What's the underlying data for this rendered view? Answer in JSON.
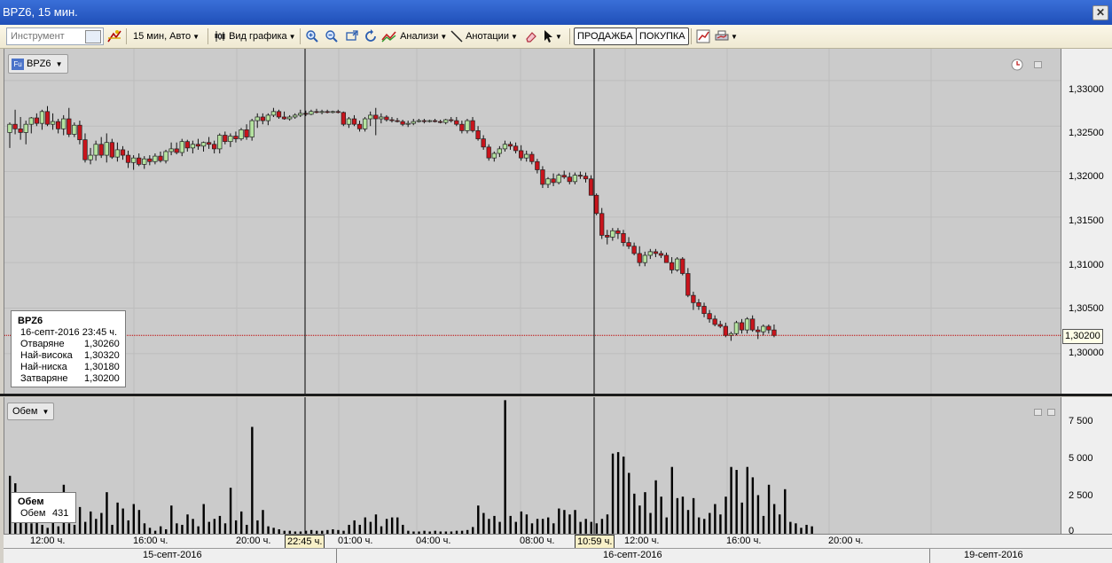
{
  "window": {
    "title": "BPZ6, 15 мин."
  },
  "toolbar": {
    "instrument_placeholder": "Инструмент",
    "interval": "15 мин, Авто",
    "chart_type": "Вид графика",
    "analysis": "Анализи",
    "annotations": "Анотации",
    "sell": "ПРОДАЖБА",
    "buy": "ПОКУПКА"
  },
  "chart": {
    "symbol": "BPZ6",
    "info": {
      "symbol": "BPZ6",
      "datetime": "16-септ-2016 23:45 ч.",
      "rows": [
        {
          "label": "Отваряне",
          "value": "1,30260"
        },
        {
          "label": "Най-висока",
          "value": "1,30320"
        },
        {
          "label": "Най-ниска",
          "value": "1,30180"
        },
        {
          "label": "Затваряне",
          "value": "1,30200"
        }
      ]
    },
    "price_axis": [
      "1,33000",
      "1,32500",
      "1,32000",
      "1,31500",
      "1,31000",
      "1,30500",
      "1,30000"
    ],
    "last_price": "1,30200",
    "volume_axis": [
      "7 500",
      "5 000",
      "2 500",
      "0"
    ],
    "volume_label": "Обем",
    "volume_info": {
      "title": "Обем",
      "label": "Обем",
      "value": "431"
    },
    "time_axis": [
      "12:00 ч.",
      "16:00 ч.",
      "20:00 ч.",
      "01:00 ч.",
      "04:00 ч.",
      "08:00 ч.",
      "12:00 ч.",
      "16:00 ч.",
      "20:00 ч."
    ],
    "highlight_times": [
      "22:45 ч.",
      "10:59 ч."
    ],
    "dates": [
      "15-септ-2016",
      "16-септ-2016",
      "19-септ-2016"
    ]
  },
  "colors": {
    "up": "#b5e3a0",
    "down": "#c8141c",
    "background": "#cbcbcb",
    "price_line": "#c00000"
  },
  "chart_data": {
    "type": "candlestick",
    "title": "BPZ6, 15 мин.",
    "y_range": [
      1.2955,
      1.3335
    ],
    "ohlc": [
      [
        1.3243,
        1.3254,
        1.3226,
        1.3252
      ],
      [
        1.3252,
        1.3268,
        1.3241,
        1.3247
      ],
      [
        1.3247,
        1.326,
        1.3235,
        1.3243
      ],
      [
        1.3243,
        1.3256,
        1.323,
        1.3252
      ],
      [
        1.3252,
        1.326,
        1.3242,
        1.3259
      ],
      [
        1.3259,
        1.3264,
        1.325,
        1.3253
      ],
      [
        1.3253,
        1.3268,
        1.3246,
        1.3266
      ],
      [
        1.3266,
        1.3272,
        1.325,
        1.3252
      ],
      [
        1.3252,
        1.3264,
        1.3246,
        1.3255
      ],
      [
        1.3255,
        1.3258,
        1.3242,
        1.3247
      ],
      [
        1.3247,
        1.3262,
        1.324,
        1.3258
      ],
      [
        1.3258,
        1.327,
        1.3238,
        1.3241
      ],
      [
        1.3241,
        1.3254,
        1.3238,
        1.3251
      ],
      [
        1.3251,
        1.3256,
        1.323,
        1.3235
      ],
      [
        1.3235,
        1.3242,
        1.321,
        1.3213
      ],
      [
        1.3213,
        1.3226,
        1.3208,
        1.3218
      ],
      [
        1.3218,
        1.3234,
        1.3212,
        1.323
      ],
      [
        1.323,
        1.3238,
        1.3215,
        1.3218
      ],
      [
        1.3218,
        1.3242,
        1.321,
        1.3232
      ],
      [
        1.3232,
        1.3236,
        1.3214,
        1.3216
      ],
      [
        1.3216,
        1.3232,
        1.3211,
        1.3224
      ],
      [
        1.3224,
        1.3228,
        1.3213,
        1.3218
      ],
      [
        1.3218,
        1.3223,
        1.3204,
        1.321
      ],
      [
        1.321,
        1.3218,
        1.3202,
        1.3215
      ],
      [
        1.3215,
        1.322,
        1.3206,
        1.3208
      ],
      [
        1.3208,
        1.3217,
        1.3203,
        1.3214
      ],
      [
        1.3214,
        1.3218,
        1.3207,
        1.3211
      ],
      [
        1.3211,
        1.322,
        1.3208,
        1.3217
      ],
      [
        1.3217,
        1.3222,
        1.321,
        1.3212
      ],
      [
        1.3212,
        1.3224,
        1.3209,
        1.3222
      ],
      [
        1.3222,
        1.3232,
        1.3218,
        1.3225
      ],
      [
        1.3225,
        1.3232,
        1.3219,
        1.3221
      ],
      [
        1.3221,
        1.3236,
        1.3217,
        1.3233
      ],
      [
        1.3233,
        1.3235,
        1.3222,
        1.3226
      ],
      [
        1.3226,
        1.3234,
        1.322,
        1.323
      ],
      [
        1.323,
        1.3236,
        1.3224,
        1.3228
      ],
      [
        1.3228,
        1.3233,
        1.3222,
        1.3232
      ],
      [
        1.3232,
        1.3238,
        1.3225,
        1.323
      ],
      [
        1.323,
        1.3234,
        1.322,
        1.3225
      ],
      [
        1.3225,
        1.3242,
        1.322,
        1.324
      ],
      [
        1.324,
        1.3244,
        1.323,
        1.3233
      ],
      [
        1.3233,
        1.3242,
        1.3227,
        1.3239
      ],
      [
        1.3239,
        1.3244,
        1.3232,
        1.3236
      ],
      [
        1.3236,
        1.3248,
        1.3234,
        1.3246
      ],
      [
        1.3246,
        1.3252,
        1.3235,
        1.3238
      ],
      [
        1.3238,
        1.3258,
        1.3234,
        1.3256
      ],
      [
        1.3256,
        1.3264,
        1.3248,
        1.326
      ],
      [
        1.326,
        1.3264,
        1.3252,
        1.3256
      ],
      [
        1.3256,
        1.3264,
        1.3251,
        1.3262
      ],
      [
        1.3262,
        1.327,
        1.326,
        1.3266
      ],
      [
        1.3266,
        1.3268,
        1.3258,
        1.326
      ],
      [
        1.326,
        1.3266,
        1.3257,
        1.3258
      ],
      [
        1.3258,
        1.3262,
        1.3256,
        1.326
      ],
      [
        1.326,
        1.3264,
        1.3258,
        1.3262
      ],
      [
        1.3262,
        1.3268,
        1.326,
        1.3264
      ],
      [
        1.3264,
        1.3267,
        1.3261,
        1.3263
      ],
      [
        1.3263,
        1.3268,
        1.3262,
        1.3266
      ],
      [
        1.3266,
        1.3269,
        1.3264,
        1.3265
      ],
      [
        1.3265,
        1.3268,
        1.3263,
        1.3266
      ],
      [
        1.3266,
        1.3268,
        1.3264,
        1.3265
      ],
      [
        1.3265,
        1.3267,
        1.3264,
        1.3266
      ],
      [
        1.3266,
        1.3268,
        1.3264,
        1.3265
      ],
      [
        1.3265,
        1.3266,
        1.325,
        1.3252
      ],
      [
        1.3252,
        1.326,
        1.3248,
        1.3258
      ],
      [
        1.3258,
        1.3262,
        1.325,
        1.3252
      ],
      [
        1.3252,
        1.3256,
        1.3244,
        1.3247
      ],
      [
        1.3247,
        1.326,
        1.3244,
        1.3258
      ],
      [
        1.3258,
        1.3266,
        1.325,
        1.3262
      ],
      [
        1.3262,
        1.327,
        1.324,
        1.3258
      ],
      [
        1.3258,
        1.3264,
        1.3253,
        1.326
      ],
      [
        1.326,
        1.3262,
        1.3255,
        1.3257
      ],
      [
        1.3257,
        1.326,
        1.3254,
        1.3256
      ],
      [
        1.3256,
        1.3259,
        1.3254,
        1.3255
      ],
      [
        1.3255,
        1.3257,
        1.325,
        1.3252
      ],
      [
        1.3252,
        1.3256,
        1.3249,
        1.3253
      ],
      [
        1.3253,
        1.3258,
        1.3251,
        1.3255
      ],
      [
        1.3255,
        1.3258,
        1.3254,
        1.3256
      ],
      [
        1.3256,
        1.3258,
        1.3253,
        1.3255
      ],
      [
        1.3255,
        1.3257,
        1.3254,
        1.3256
      ],
      [
        1.3256,
        1.3258,
        1.3254,
        1.3255
      ],
      [
        1.3255,
        1.3257,
        1.3253,
        1.3254
      ],
      [
        1.3254,
        1.3258,
        1.3252,
        1.3257
      ],
      [
        1.3257,
        1.326,
        1.3254,
        1.3256
      ],
      [
        1.3256,
        1.326,
        1.325,
        1.3252
      ],
      [
        1.3252,
        1.3256,
        1.3242,
        1.3245
      ],
      [
        1.3245,
        1.3258,
        1.3242,
        1.3256
      ],
      [
        1.3256,
        1.326,
        1.3243,
        1.3245
      ],
      [
        1.3245,
        1.325,
        1.3234,
        1.3236
      ],
      [
        1.3236,
        1.324,
        1.3224,
        1.3227
      ],
      [
        1.3227,
        1.323,
        1.3212,
        1.3215
      ],
      [
        1.3215,
        1.3222,
        1.3211,
        1.322
      ],
      [
        1.322,
        1.3228,
        1.3216,
        1.3225
      ],
      [
        1.3225,
        1.3234,
        1.3222,
        1.323
      ],
      [
        1.323,
        1.3233,
        1.3224,
        1.3228
      ],
      [
        1.3228,
        1.3232,
        1.322,
        1.3223
      ],
      [
        1.3223,
        1.3229,
        1.3212,
        1.3215
      ],
      [
        1.3215,
        1.3223,
        1.3211,
        1.3219
      ],
      [
        1.3219,
        1.3222,
        1.3208,
        1.3211
      ],
      [
        1.3211,
        1.3214,
        1.3198,
        1.3202
      ],
      [
        1.3202,
        1.3206,
        1.3182,
        1.3186
      ],
      [
        1.3186,
        1.3194,
        1.3182,
        1.3192
      ],
      [
        1.3192,
        1.3198,
        1.3184,
        1.3188
      ],
      [
        1.3188,
        1.3198,
        1.3186,
        1.3196
      ],
      [
        1.3196,
        1.3201,
        1.3192,
        1.3194
      ],
      [
        1.3194,
        1.3199,
        1.3186,
        1.3189
      ],
      [
        1.3189,
        1.3199,
        1.3186,
        1.3196
      ],
      [
        1.3196,
        1.32,
        1.3192,
        1.3195
      ],
      [
        1.3195,
        1.3199,
        1.3188,
        1.3192
      ],
      [
        1.3192,
        1.3196,
        1.3174,
        1.3174
      ],
      [
        1.3174,
        1.3176,
        1.3152,
        1.3154
      ],
      [
        1.3154,
        1.316,
        1.3126,
        1.313
      ],
      [
        1.313,
        1.3136,
        1.312,
        1.3128
      ],
      [
        1.3128,
        1.3138,
        1.3124,
        1.3135
      ],
      [
        1.3135,
        1.3138,
        1.3126,
        1.3132
      ],
      [
        1.3132,
        1.3136,
        1.3118,
        1.3122
      ],
      [
        1.3122,
        1.3128,
        1.3115,
        1.3118
      ],
      [
        1.3118,
        1.3122,
        1.3108,
        1.311
      ],
      [
        1.311,
        1.3118,
        1.3096,
        1.31
      ],
      [
        1.31,
        1.3112,
        1.3096,
        1.3108
      ],
      [
        1.3108,
        1.3115,
        1.3104,
        1.3112
      ],
      [
        1.3112,
        1.3115,
        1.3106,
        1.311
      ],
      [
        1.311,
        1.3113,
        1.3105,
        1.3108
      ],
      [
        1.3108,
        1.3111,
        1.31,
        1.31
      ],
      [
        1.31,
        1.3106,
        1.3088,
        1.3092
      ],
      [
        1.3092,
        1.3106,
        1.309,
        1.3104
      ],
      [
        1.3104,
        1.3106,
        1.3086,
        1.3088
      ],
      [
        1.3088,
        1.3094,
        1.3062,
        1.3064
      ],
      [
        1.3064,
        1.3068,
        1.3048,
        1.3056
      ],
      [
        1.3056,
        1.306,
        1.3048,
        1.3052
      ],
      [
        1.3052,
        1.3056,
        1.304,
        1.3044
      ],
      [
        1.3044,
        1.3048,
        1.3034,
        1.3038
      ],
      [
        1.3038,
        1.3042,
        1.303,
        1.3032
      ],
      [
        1.3032,
        1.3036,
        1.3028,
        1.303
      ],
      [
        1.303,
        1.3034,
        1.3018,
        1.302
      ],
      [
        1.302,
        1.3024,
        1.3014,
        1.3022
      ],
      [
        1.3022,
        1.3036,
        1.302,
        1.3034
      ],
      [
        1.3034,
        1.3038,
        1.3022,
        1.3026
      ],
      [
        1.3026,
        1.304,
        1.3022,
        1.3038
      ],
      [
        1.3038,
        1.3042,
        1.3024,
        1.3026
      ],
      [
        1.3026,
        1.303,
        1.3016,
        1.3024
      ],
      [
        1.3024,
        1.3032,
        1.302,
        1.303
      ],
      [
        1.303,
        1.3032,
        1.3022,
        1.3026
      ],
      [
        1.3026,
        1.3032,
        1.3018,
        1.302
      ]
    ],
    "volume_range": [
      0,
      9200
    ],
    "volumes": [
      3900,
      3400,
      1200,
      2500,
      700,
      1800,
      600,
      400,
      1000,
      500,
      3300,
      700,
      600,
      1800,
      800,
      1500,
      1000,
      1400,
      2800,
      600,
      2100,
      1700,
      900,
      2000,
      1600,
      700,
      400,
      200,
      500,
      300,
      1900,
      700,
      600,
      1300,
      1000,
      500,
      2000,
      800,
      1000,
      1200,
      700,
      3100,
      900,
      1500,
      600,
      7200,
      900,
      1600,
      500,
      400,
      300,
      200,
      200,
      150,
      150,
      200,
      250,
      200,
      200,
      250,
      300,
      250,
      200,
      600,
      900,
      600,
      1100,
      800,
      1300,
      500,
      1000,
      1100,
      1100,
      600,
      200,
      150,
      150,
      200,
      150,
      200,
      150,
      150,
      150,
      200,
      200,
      250,
      450,
      1900,
      1400,
      1000,
      1200,
      800,
      9000,
      1200,
      800,
      1500,
      1300,
      700,
      1000,
      1000,
      1100,
      700,
      1700,
      1600,
      1300,
      1600,
      800,
      1000,
      800,
      700,
      1000,
      1300,
      5400,
      5500,
      5200,
      4100,
      2700,
      1900,
      2800,
      1400,
      3600,
      2500,
      1100,
      4500,
      2400,
      2500,
      1600,
      2400,
      1100,
      1000,
      1400,
      2000,
      1300,
      2500,
      4500,
      4300,
      2100,
      4500,
      3800,
      2600,
      1200,
      3300,
      2000,
      1300,
      3000,
      800,
      700,
      400,
      600,
      500
    ]
  }
}
